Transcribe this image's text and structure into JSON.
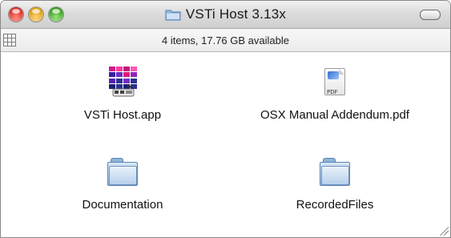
{
  "window": {
    "title": "VSTi Host 3.13x",
    "status": "4 items, 17.76 GB available"
  },
  "icons": {
    "title_folder": "folder-icon",
    "view_toggle": "icon-view-grid-icon",
    "toolbar_toggle": "toolbar-pill-icon",
    "resize": "resize-grip-icon"
  },
  "items": [
    {
      "name": "VSTi Host.app",
      "icon": "application-icon"
    },
    {
      "name": "OSX Manual Addendum.pdf",
      "icon": "pdf-document-icon"
    },
    {
      "name": "Documentation",
      "icon": "folder-icon"
    },
    {
      "name": "RecordedFiles",
      "icon": "folder-icon"
    }
  ],
  "colors": {
    "close": "#d4261c",
    "minimize": "#d39a0b",
    "zoom": "#2e9c16",
    "folder": "#92b6dc"
  }
}
